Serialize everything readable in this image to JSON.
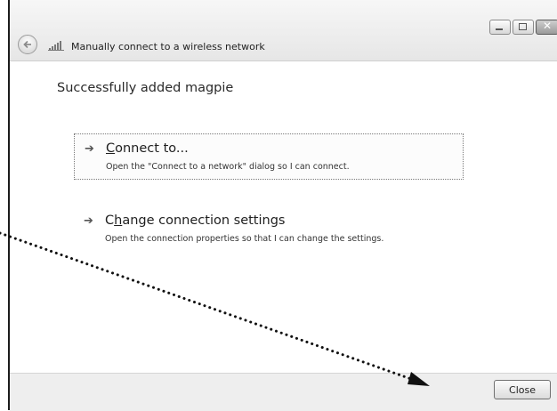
{
  "window": {
    "title": "Manually connect to a wireless network",
    "controls": [
      "minimize",
      "maximize",
      "close"
    ],
    "icons": {
      "back": "back-arrow-icon",
      "network": "wireless-signal-icon"
    }
  },
  "main": {
    "heading": "Successfully added magpie",
    "options": [
      {
        "label_pre": "",
        "label_mnemonic": "C",
        "label_post": "onnect to...",
        "description": "Open the \"Connect to a network\" dialog so I can connect."
      },
      {
        "label_pre": "C",
        "label_mnemonic": "h",
        "label_post": "ange connection settings",
        "description": "Open the connection properties so that I can change the settings."
      }
    ]
  },
  "footer": {
    "close_label": "Close"
  }
}
